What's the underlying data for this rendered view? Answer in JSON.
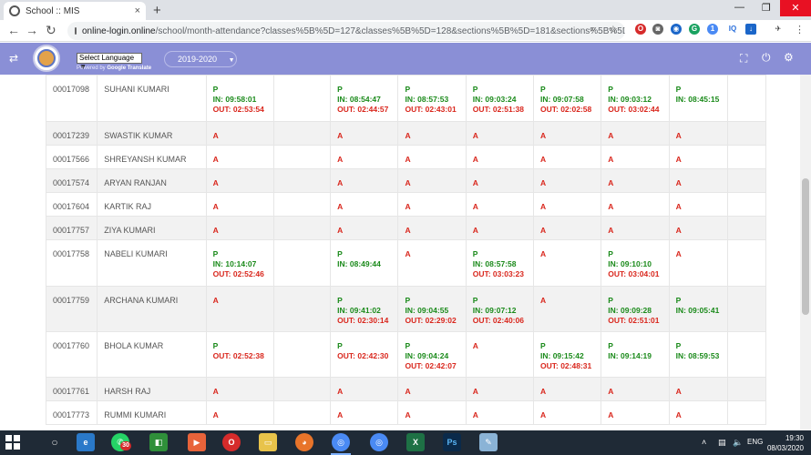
{
  "browser": {
    "tab_title": "School :: MIS",
    "tab_close": "×",
    "new_tab": "+",
    "url_host": "online-login.online",
    "url_path": "/school/month-attendance?classes%5B%5D=127&classes%5B%5D=128&sections%5B%5D=181&sections%5B%5D...",
    "ext_badge": "1",
    "ext_iq": "IQ"
  },
  "header": {
    "language_select": "Select Language ▼",
    "powered_by": "Powered by",
    "translate": "Google Translate",
    "session_year": "2019-2020",
    "session_caret": "▼"
  },
  "attendance": {
    "rows": [
      {
        "id": "00017098",
        "name": "SUHANI KUMARI",
        "cells": [
          {
            "status": "P",
            "in": "IN: 09:58:01",
            "out": "OUT: 02:53:54"
          },
          {
            "status": ""
          },
          {
            "status": "P",
            "in": "IN: 08:54:47",
            "out": "OUT: 02:44:57"
          },
          {
            "status": "P",
            "in": "IN: 08:57:53",
            "out": "OUT: 02:43:01"
          },
          {
            "status": "P",
            "in": "IN: 09:03:24",
            "out": "OUT: 02:51:38"
          },
          {
            "status": "P",
            "in": "IN: 09:07:58",
            "out": "OUT: 02:02:58"
          },
          {
            "status": "P",
            "in": "IN: 09:03:12",
            "out": "OUT: 03:02:44"
          },
          {
            "status": "P",
            "in": "IN: 08:45:15"
          },
          {
            "status": ""
          }
        ]
      },
      {
        "id": "00017239",
        "name": "SWASTIK KUMAR",
        "cells": [
          {
            "status": "A"
          },
          {
            "status": ""
          },
          {
            "status": "A"
          },
          {
            "status": "A"
          },
          {
            "status": "A"
          },
          {
            "status": "A"
          },
          {
            "status": "A"
          },
          {
            "status": "A"
          },
          {
            "status": ""
          }
        ]
      },
      {
        "id": "00017566",
        "name": "SHREYANSH KUMAR",
        "cells": [
          {
            "status": "A"
          },
          {
            "status": ""
          },
          {
            "status": "A"
          },
          {
            "status": "A"
          },
          {
            "status": "A"
          },
          {
            "status": "A"
          },
          {
            "status": "A"
          },
          {
            "status": "A"
          },
          {
            "status": ""
          }
        ]
      },
      {
        "id": "00017574",
        "name": "ARYAN RANJAN",
        "cells": [
          {
            "status": "A"
          },
          {
            "status": ""
          },
          {
            "status": "A"
          },
          {
            "status": "A"
          },
          {
            "status": "A"
          },
          {
            "status": "A"
          },
          {
            "status": "A"
          },
          {
            "status": "A"
          },
          {
            "status": ""
          }
        ]
      },
      {
        "id": "00017604",
        "name": "KARTIK RAJ",
        "cells": [
          {
            "status": "A"
          },
          {
            "status": ""
          },
          {
            "status": "A"
          },
          {
            "status": "A"
          },
          {
            "status": "A"
          },
          {
            "status": "A"
          },
          {
            "status": "A"
          },
          {
            "status": "A"
          },
          {
            "status": ""
          }
        ]
      },
      {
        "id": "00017757",
        "name": "ZIYA KUMARI",
        "cells": [
          {
            "status": "A"
          },
          {
            "status": ""
          },
          {
            "status": "A"
          },
          {
            "status": "A"
          },
          {
            "status": "A"
          },
          {
            "status": "A"
          },
          {
            "status": "A"
          },
          {
            "status": "A"
          },
          {
            "status": ""
          }
        ]
      },
      {
        "id": "00017758",
        "name": "NABELI KUMARI",
        "cells": [
          {
            "status": "P",
            "in": "IN: 10:14:07",
            "out": "OUT: 02:52:46"
          },
          {
            "status": ""
          },
          {
            "status": "P",
            "in": "IN: 08:49:44"
          },
          {
            "status": "A"
          },
          {
            "status": "P",
            "in": "IN: 08:57:58",
            "out": "OUT: 03:03:23"
          },
          {
            "status": "A"
          },
          {
            "status": "P",
            "in": "IN: 09:10:10",
            "out": "OUT: 03:04:01"
          },
          {
            "status": "A"
          },
          {
            "status": ""
          }
        ]
      },
      {
        "id": "00017759",
        "name": "ARCHANA KUMARI",
        "cells": [
          {
            "status": "A"
          },
          {
            "status": ""
          },
          {
            "status": "P",
            "in": "IN: 09:41:02",
            "out": "OUT: 02:30:14"
          },
          {
            "status": "P",
            "in": "IN: 09:04:55",
            "out": "OUT: 02:29:02"
          },
          {
            "status": "P",
            "in": "IN: 09:07:12",
            "out": "OUT: 02:40:06"
          },
          {
            "status": "A"
          },
          {
            "status": "P",
            "in": "IN: 09:09:28",
            "out": "OUT: 02:51:01"
          },
          {
            "status": "P",
            "in": "IN: 09:05:41"
          },
          {
            "status": ""
          }
        ]
      },
      {
        "id": "00017760",
        "name": "BHOLA KUMAR",
        "cells": [
          {
            "status": "P",
            "out": "OUT: 02:52:38"
          },
          {
            "status": ""
          },
          {
            "status": "P",
            "out": "OUT: 02:42:30"
          },
          {
            "status": "P",
            "in": "IN: 09:04:24",
            "out": "OUT: 02:42:07"
          },
          {
            "status": "A"
          },
          {
            "status": "P",
            "in": "IN: 09:15:42",
            "out": "OUT: 02:48:31"
          },
          {
            "status": "P",
            "in": "IN: 09:14:19"
          },
          {
            "status": "P",
            "in": "IN: 08:59:53"
          },
          {
            "status": ""
          }
        ]
      },
      {
        "id": "00017761",
        "name": "HARSH RAJ",
        "cells": [
          {
            "status": "A"
          },
          {
            "status": ""
          },
          {
            "status": "A"
          },
          {
            "status": "A"
          },
          {
            "status": "A"
          },
          {
            "status": "A"
          },
          {
            "status": "A"
          },
          {
            "status": "A"
          },
          {
            "status": ""
          }
        ]
      },
      {
        "id": "00017773",
        "name": "RUMMI KUMARI",
        "cells": [
          {
            "status": "A"
          },
          {
            "status": ""
          },
          {
            "status": "A"
          },
          {
            "status": "A"
          },
          {
            "status": "A"
          },
          {
            "status": "A"
          },
          {
            "status": "A"
          },
          {
            "status": "A"
          },
          {
            "status": ""
          }
        ]
      }
    ]
  },
  "taskbar": {
    "time": "19:30",
    "date": "08/03/2020",
    "whatsapp_badge": "30",
    "photoshop_label": "Ps",
    "language": "ENG"
  }
}
